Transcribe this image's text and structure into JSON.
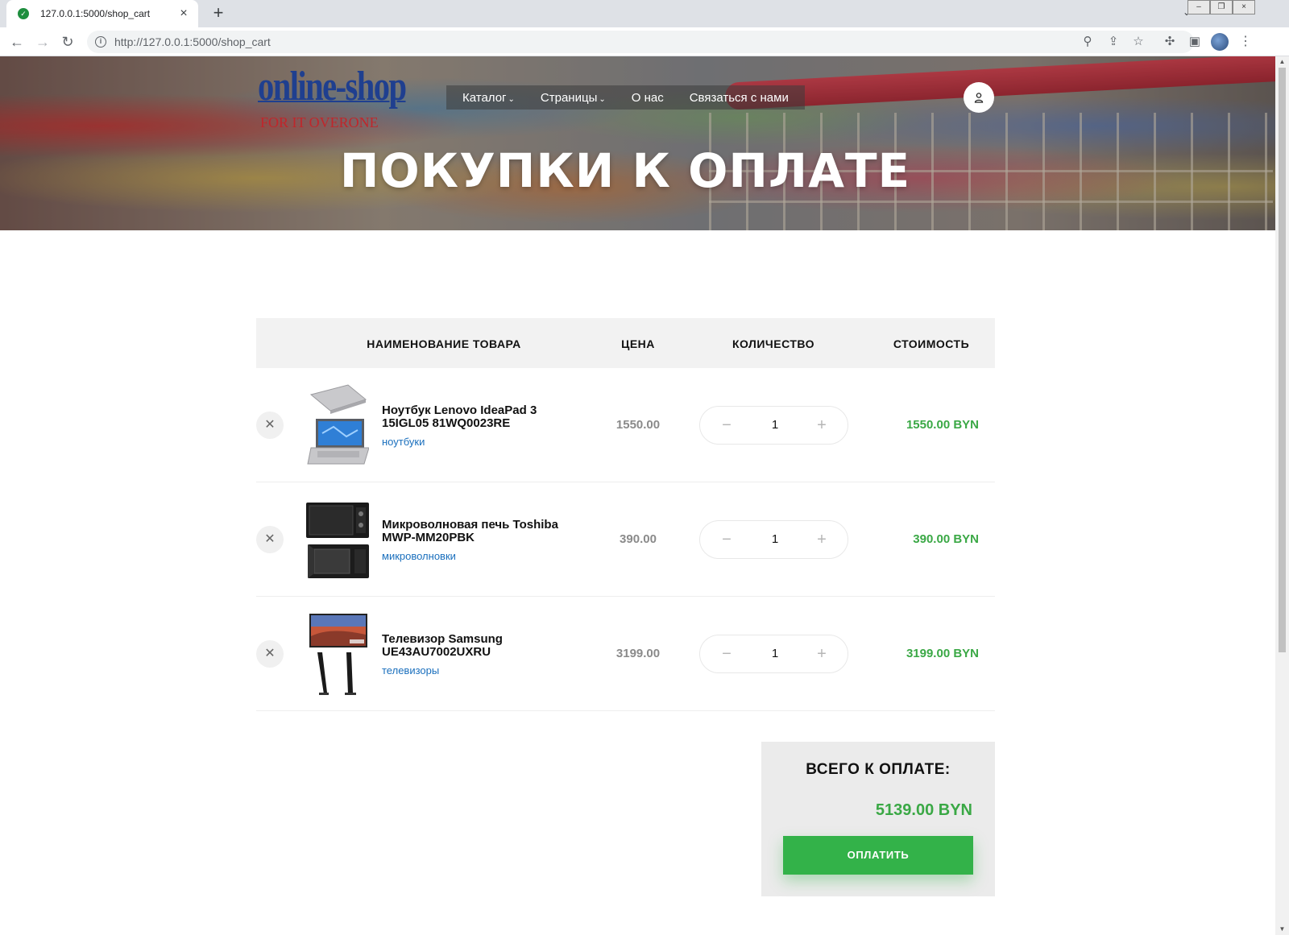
{
  "browser": {
    "tab_title": "127.0.0.1:5000/shop_cart",
    "url_host": "http://127.0.0.1",
    "url_rest": ":5000/shop_cart"
  },
  "site": {
    "logo_main": "online-shop",
    "logo_sub": "FOR IT OVERONE",
    "menu": [
      {
        "label": "Каталог",
        "has_dropdown": true
      },
      {
        "label": "Страницы",
        "has_dropdown": true
      },
      {
        "label": "О нас",
        "has_dropdown": false
      },
      {
        "label": "Связаться с нами",
        "has_dropdown": false
      }
    ],
    "page_title": "ПОКУПКИ К ОПЛАТЕ"
  },
  "cart": {
    "headers": {
      "name": "НАИМЕНОВАНИЕ ТОВАРА",
      "price": "ЦЕНА",
      "qty": "КОЛИЧЕСТВО",
      "total": "СТОИМОСТЬ"
    },
    "items": [
      {
        "name_line1": "Ноутбук Lenovo IdeaPad 3",
        "name_line2": "15IGL05 81WQ0023RE",
        "category": "ноутбуки",
        "price": "1550.00",
        "qty": "1",
        "total": "1550.00 BYN",
        "image": "laptop"
      },
      {
        "name_line1": "Микроволновая печь Toshiba",
        "name_line2": "MWP-MM20PBK",
        "category": "микроволновки",
        "price": "390.00",
        "qty": "1",
        "total": "390.00 BYN",
        "image": "microwave"
      },
      {
        "name_line1": "Телевизор Samsung",
        "name_line2": "UE43AU7002UXRU",
        "category": "телевизоры",
        "price": "3199.00",
        "qty": "1",
        "total": "3199.00 BYN",
        "image": "tv"
      }
    ],
    "summary_label": "ВСЕГО К ОПЛАТЕ:",
    "summary_total": "5139.00 BYN",
    "pay_button": "ОПЛАТИТЬ"
  },
  "colors": {
    "accent_green": "#33b249",
    "price_green": "#3aa845",
    "logo_blue": "#1f3f8f",
    "logo_red": "#c0262b",
    "category_link": "#1a6fbd"
  }
}
